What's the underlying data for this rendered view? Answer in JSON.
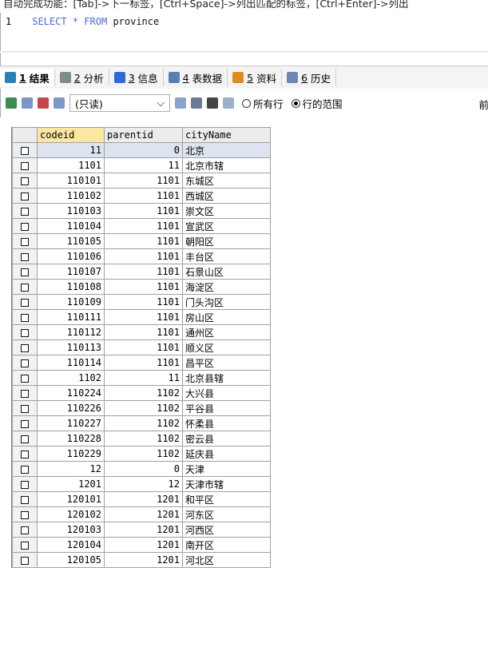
{
  "hint": "自动完成功能：[Tab]->下一标签，[Ctrl+Space]->列出匹配的标签，[Ctrl+Enter]->列出",
  "editor": {
    "line_number": "1",
    "sql_select": "SELECT",
    "sql_star": "*",
    "sql_from": "FROM",
    "sql_table": "province",
    "scroll_arrow": "<"
  },
  "tabs": [
    {
      "num": "1",
      "label": "结果",
      "icon": "results-icon",
      "active": true
    },
    {
      "num": "2",
      "label": "分析",
      "icon": "analyze-icon"
    },
    {
      "num": "3",
      "label": "信息",
      "icon": "info-icon"
    },
    {
      "num": "4",
      "label": "表数据",
      "icon": "table-data-icon"
    },
    {
      "num": "5",
      "label": "资料",
      "icon": "profile-icon"
    },
    {
      "num": "6",
      "label": "历史",
      "icon": "history-icon"
    }
  ],
  "toolbar": {
    "mode": "(只读)",
    "radio_all": "所有行",
    "radio_range": "行的范围",
    "cut_label": "前"
  },
  "grid": {
    "columns": [
      "codeid",
      "parentid",
      "cityName"
    ],
    "rows": [
      [
        "11",
        "0",
        "北京"
      ],
      [
        "1101",
        "11",
        "北京市辖"
      ],
      [
        "110101",
        "1101",
        "东城区"
      ],
      [
        "110102",
        "1101",
        "西城区"
      ],
      [
        "110103",
        "1101",
        "崇文区"
      ],
      [
        "110104",
        "1101",
        "宣武区"
      ],
      [
        "110105",
        "1101",
        "朝阳区"
      ],
      [
        "110106",
        "1101",
        "丰台区"
      ],
      [
        "110107",
        "1101",
        "石景山区"
      ],
      [
        "110108",
        "1101",
        "海淀区"
      ],
      [
        "110109",
        "1101",
        "门头沟区"
      ],
      [
        "110111",
        "1101",
        "房山区"
      ],
      [
        "110112",
        "1101",
        "通州区"
      ],
      [
        "110113",
        "1101",
        "顺义区"
      ],
      [
        "110114",
        "1101",
        "昌平区"
      ],
      [
        "1102",
        "11",
        "北京县辖"
      ],
      [
        "110224",
        "1102",
        "大兴县"
      ],
      [
        "110226",
        "1102",
        "平谷县"
      ],
      [
        "110227",
        "1102",
        "怀柔县"
      ],
      [
        "110228",
        "1102",
        "密云县"
      ],
      [
        "110229",
        "1102",
        "延庆县"
      ],
      [
        "12",
        "0",
        "天津"
      ],
      [
        "1201",
        "12",
        "天津市辖"
      ],
      [
        "120101",
        "1201",
        "和平区"
      ],
      [
        "120102",
        "1201",
        "河东区"
      ],
      [
        "120103",
        "1201",
        "河西区"
      ],
      [
        "120104",
        "1201",
        "南开区"
      ],
      [
        "120105",
        "1201",
        "河北区"
      ]
    ]
  },
  "colors": {
    "accent_header": "#fbe7a4",
    "selected_row": "#dde4ef",
    "keyword": "#4a6bd6"
  }
}
